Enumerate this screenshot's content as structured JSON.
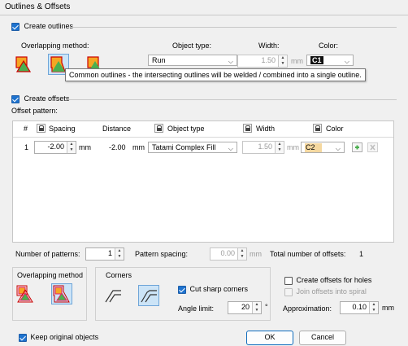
{
  "window": {
    "title": "Outlines & Offsets"
  },
  "outlines": {
    "create_label": "Create outlines",
    "overlap_label": "Overlapping method:",
    "object_type_label": "Object type:",
    "width_label": "Width:",
    "color_label": "Color:",
    "object_type_value": "Run",
    "width_value": "1.50",
    "width_unit": "mm",
    "color_value": "C1",
    "tooltip": "Common outlines - the intersecting outlines will be welded / combined into a single outline."
  },
  "offsets": {
    "create_label": "Create offsets",
    "pattern_label": "Offset pattern:",
    "columns": {
      "num": "#",
      "spacing": "Spacing",
      "distance": "Distance",
      "object_type": "Object type",
      "width": "Width",
      "color": "Color"
    },
    "rows": [
      {
        "num": "1",
        "spacing": "-2.00",
        "spacing_unit": "mm",
        "distance": "-2.00",
        "distance_unit": "mm",
        "object_type": "Tatami Complex Fill",
        "width": "1.50",
        "width_unit": "mm",
        "color": "C2"
      }
    ],
    "colors": {
      "c2": "#f5d8a0",
      "c1": "#111111"
    }
  },
  "patterns": {
    "number_label": "Number of patterns:",
    "number_value": "1",
    "spacing_label": "Pattern spacing:",
    "spacing_value": "0.00",
    "spacing_unit": "mm",
    "total_label": "Total number of offsets:",
    "total_value": "1"
  },
  "overlapping_group": {
    "title": "Overlapping method"
  },
  "corners": {
    "title": "Corners",
    "cut_label": "Cut sharp corners",
    "angle_label": "Angle limit:",
    "angle_value": "20",
    "angle_unit": "°"
  },
  "holes": {
    "create_label": "Create offsets for holes",
    "join_label": "Join offsets into spiral",
    "approx_label": "Approximation:",
    "approx_value": "0.10",
    "approx_unit": "mm"
  },
  "footer": {
    "keep_label": "Keep original objects",
    "ok_label": "OK",
    "cancel_label": "Cancel"
  }
}
